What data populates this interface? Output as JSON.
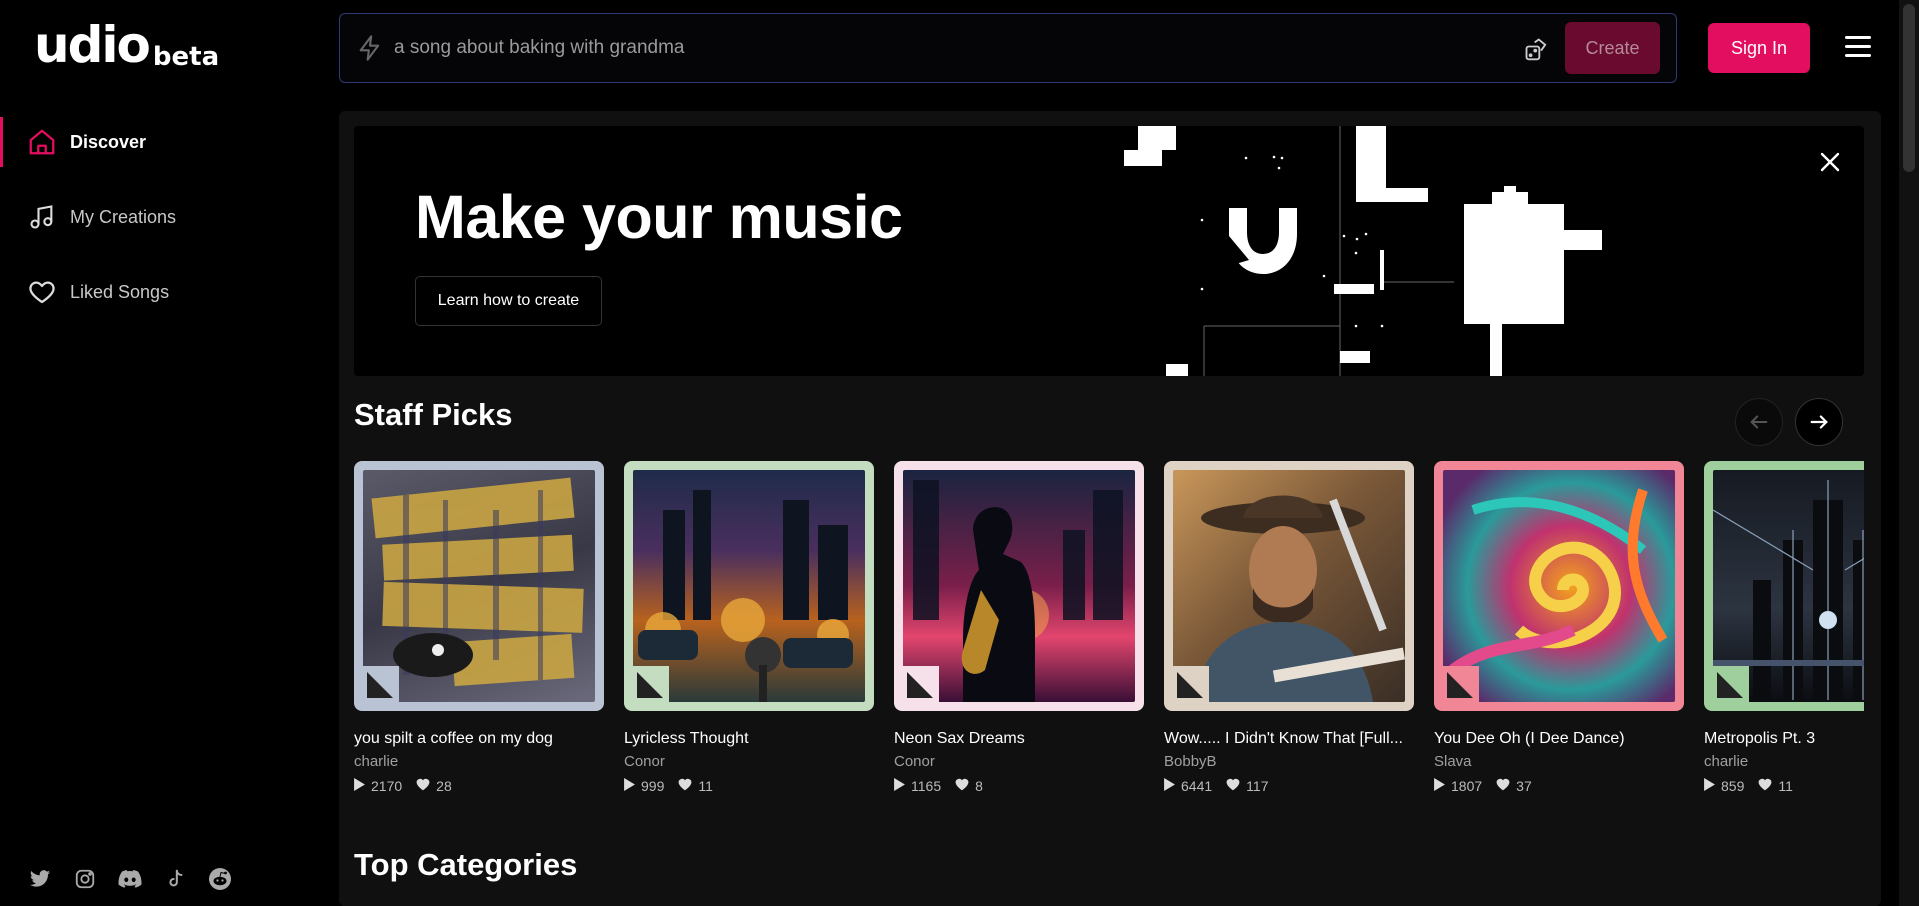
{
  "logo": {
    "word": "udio",
    "badge": "beta"
  },
  "sidebar": {
    "items": [
      {
        "label": "Discover",
        "icon": "home-icon",
        "active": true
      },
      {
        "label": "My Creations",
        "icon": "music-note-icon",
        "active": false
      },
      {
        "label": "Liked Songs",
        "icon": "heart-icon",
        "active": false
      }
    ],
    "socials": [
      "twitter-icon",
      "instagram-icon",
      "discord-icon",
      "tiktok-icon",
      "reddit-icon"
    ]
  },
  "search": {
    "placeholder": "a song about baking with grandma",
    "value": "",
    "create_label": "Create"
  },
  "header": {
    "sign_in_label": "Sign In"
  },
  "hero": {
    "title": "Make your music",
    "button_label": "Learn how to create"
  },
  "staff_picks": {
    "title": "Staff Picks",
    "cards": [
      {
        "title": "you spilt a coffee on my dog",
        "artist": "charlie",
        "plays": "2170",
        "likes": "28",
        "border": "#b9c3d3"
      },
      {
        "title": "Lyricless Thought",
        "artist": "Conor",
        "plays": "999",
        "likes": "11",
        "border": "#c4dcc0"
      },
      {
        "title": "Neon Sax Dreams",
        "artist": "Conor",
        "plays": "1165",
        "likes": "8",
        "border": "#f6e1ea"
      },
      {
        "title": "Wow..... I Didn't Know That [Full...",
        "artist": "BobbyB",
        "plays": "6441",
        "likes": "117",
        "border": "#ddd2c3"
      },
      {
        "title": "You Dee Oh (I Dee Dance)",
        "artist": "Slava",
        "plays": "1807",
        "likes": "37",
        "border": "#f08696"
      },
      {
        "title": "Metropolis Pt. 3",
        "artist": "charlie",
        "plays": "859",
        "likes": "11",
        "border": "#9fcf9d"
      }
    ]
  },
  "top_categories": {
    "title": "Top Categories"
  },
  "colors": {
    "accent": "#e30e5f",
    "search_border": "#2f3a75",
    "panel": "#101010"
  }
}
